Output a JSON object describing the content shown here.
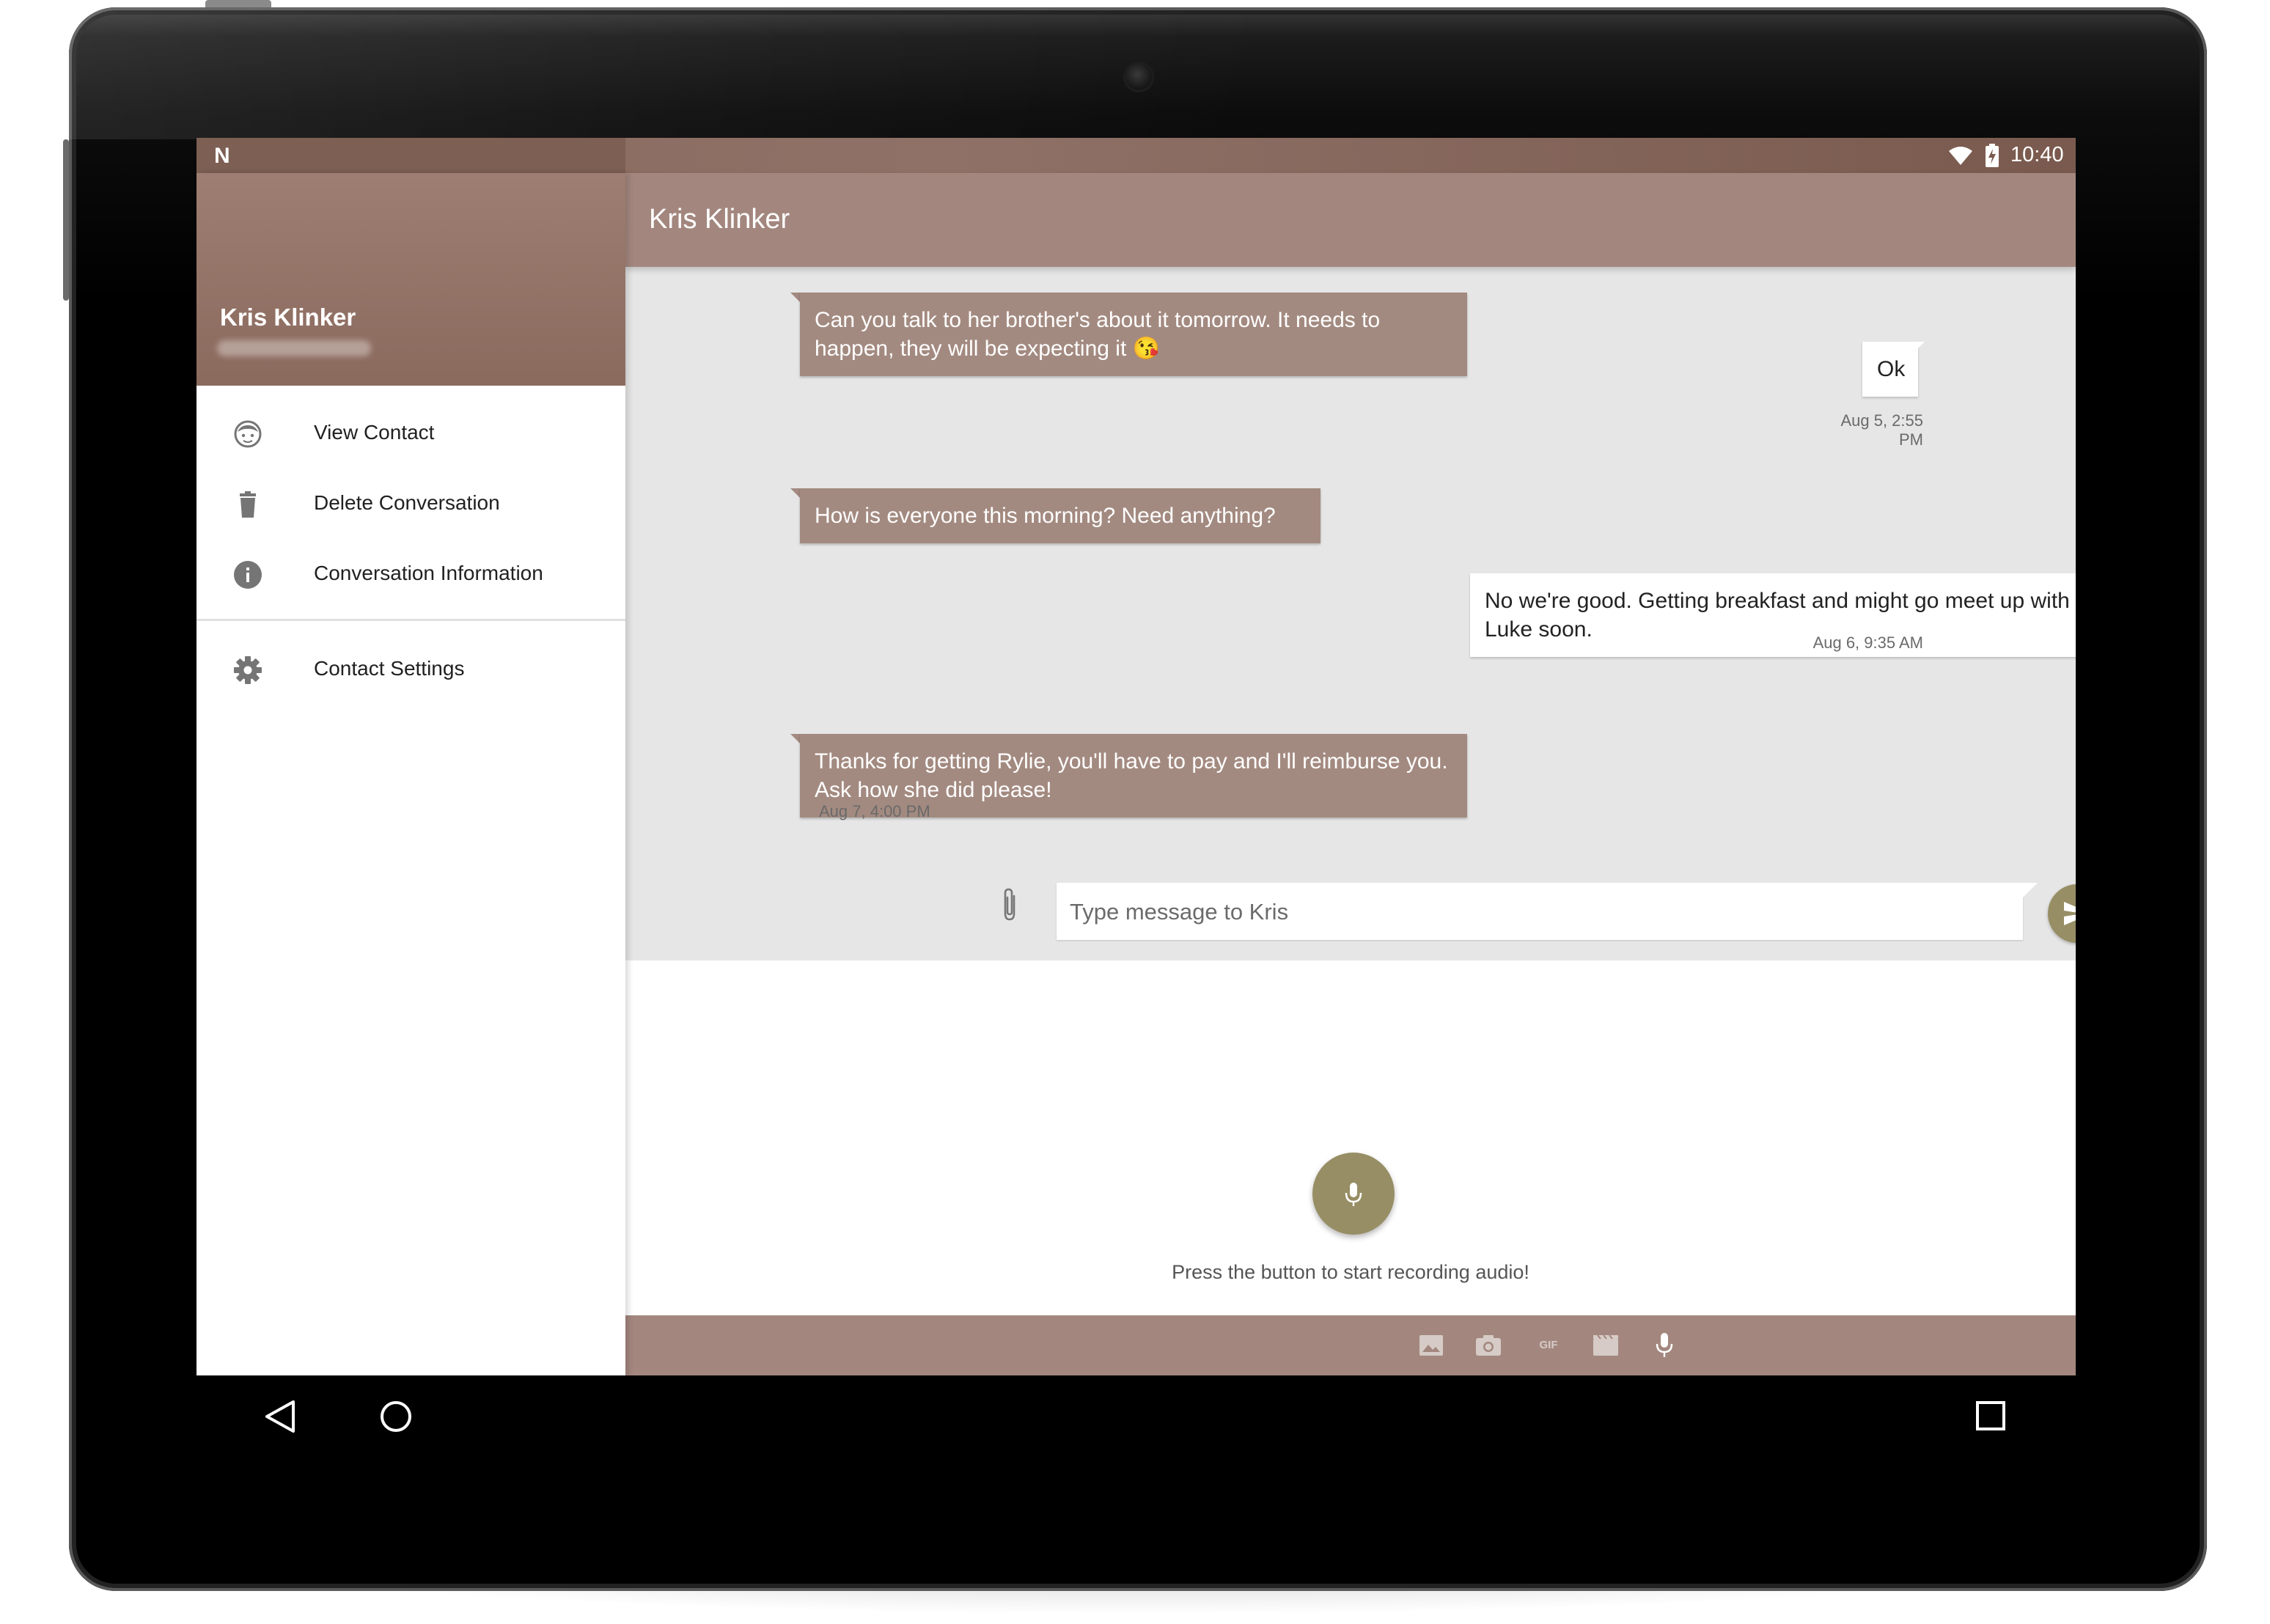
{
  "status_bar": {
    "time": "10:40",
    "notification_icon": "N"
  },
  "drawer": {
    "contact_name": "Kris Klinker",
    "menu": [
      {
        "label": "View Contact",
        "icon": "face-icon"
      },
      {
        "label": "Delete Conversation",
        "icon": "trash-icon"
      },
      {
        "label": "Conversation Information",
        "icon": "info-icon"
      },
      {
        "label": "Contact Settings",
        "icon": "gear-icon"
      }
    ]
  },
  "app_bar": {
    "title": "Kris Klinker"
  },
  "messages": [
    {
      "direction": "incoming",
      "text": "Can you talk to her brother's about it tomorrow.  It needs to happen, they will be expecting it 😘"
    },
    {
      "direction": "outgoing",
      "text": "Ok",
      "timestamp": "Aug 5, 2:55 PM"
    },
    {
      "direction": "incoming",
      "text": "How is everyone this morning?  Need anything?"
    },
    {
      "direction": "outgoing",
      "text": "No we're good. Getting breakfast and might go meet up with Luke soon.",
      "timestamp": "Aug 6, 9:35 AM"
    },
    {
      "direction": "incoming",
      "text": "Thanks for getting Rylie, you'll have to pay and I'll reimburse you.  Ask how she did please!",
      "timestamp": "Aug 7, 4:00 PM"
    }
  ],
  "composer": {
    "placeholder": "Type message to Kris"
  },
  "recorder": {
    "hint": "Press the button to start recording audio!"
  },
  "attach_bar": {
    "gif_label": "GIF"
  },
  "colors": {
    "primary": "#a3877e",
    "primary_dark": "#7d5f53",
    "accent": "#978e65",
    "incoming_bubble": "#a38a80",
    "outgoing_bubble": "#ffffff",
    "chat_background": "#e6e6e6"
  }
}
